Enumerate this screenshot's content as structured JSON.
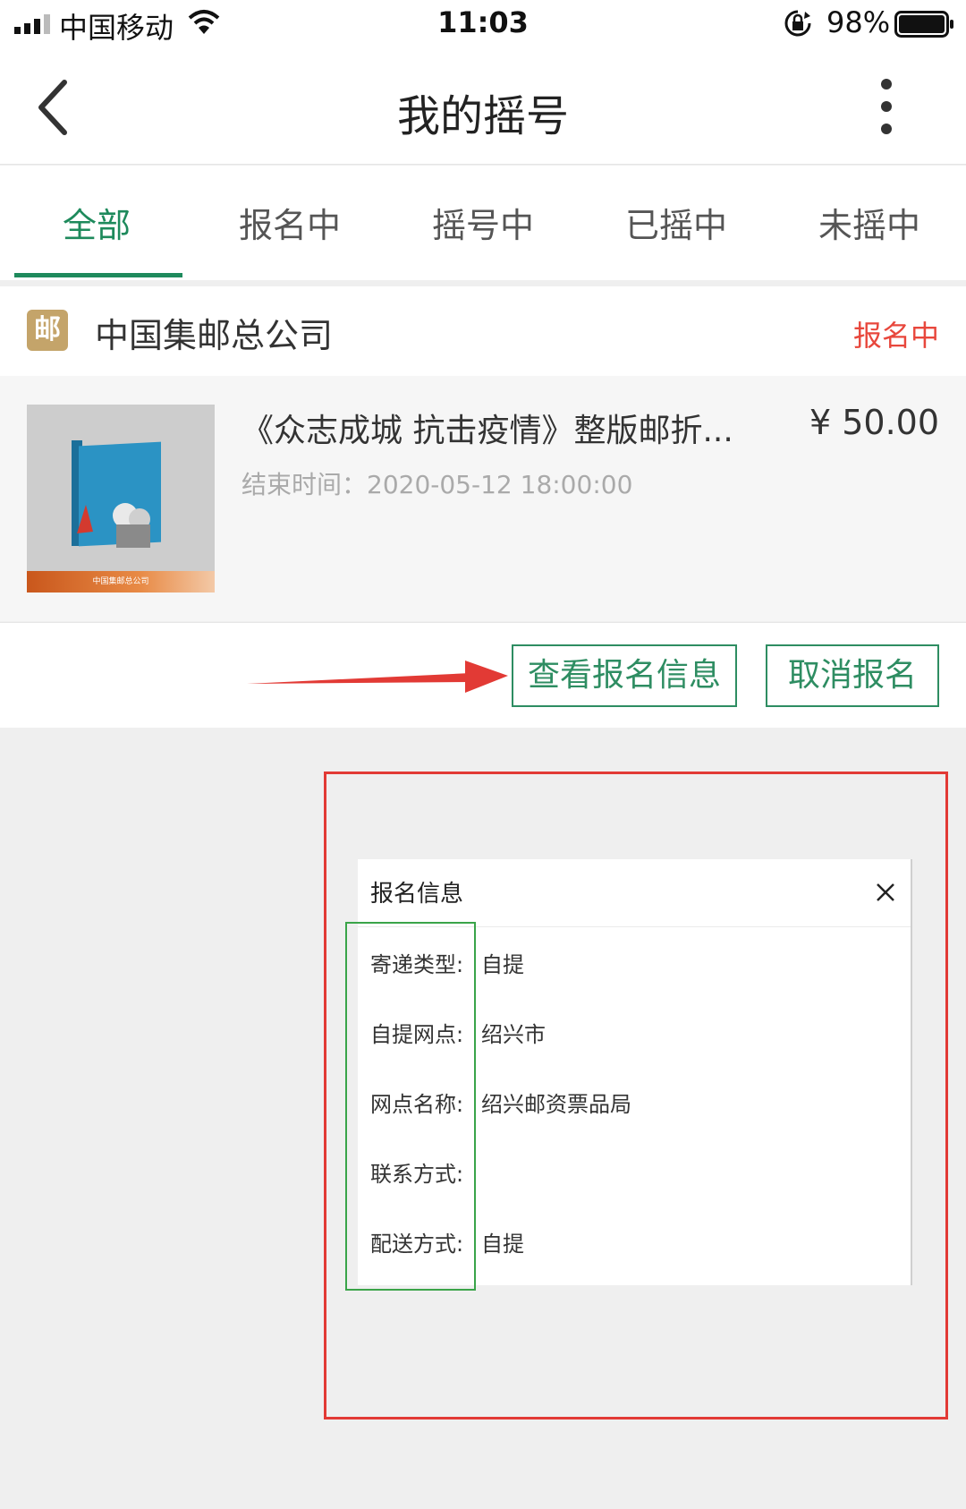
{
  "status_bar": {
    "carrier": "中国移动",
    "time": "11:03",
    "battery": "98%"
  },
  "nav": {
    "title": "我的摇号"
  },
  "tabs": [
    {
      "label": "全部",
      "active": true
    },
    {
      "label": "报名中",
      "active": false
    },
    {
      "label": "摇号中",
      "active": false
    },
    {
      "label": "已摇中",
      "active": false
    },
    {
      "label": "未摇中",
      "active": false
    }
  ],
  "shop": {
    "logo_char": "邮",
    "name": "中国集邮总公司",
    "status": "报名中"
  },
  "product": {
    "title": "《众志成城 抗击疫情》整版邮折...",
    "price": "¥ 50.00",
    "end_time": "结束时间：2020-05-12 18:00:00",
    "image_caption": "中国集邮总公司"
  },
  "actions": {
    "view_label": "查看报名信息",
    "cancel_label": "取消报名"
  },
  "dialog": {
    "title": "报名信息",
    "fields": [
      {
        "label": "寄递类型:",
        "value": "自提"
      },
      {
        "label": "自提网点:",
        "value": "绍兴市"
      },
      {
        "label": "网点名称:",
        "value": "绍兴邮资票品局"
      },
      {
        "label": "联系方式:",
        "value": ""
      },
      {
        "label": "配送方式:",
        "value": "自提"
      }
    ]
  },
  "colors": {
    "accent_green": "#1e8a5c",
    "status_red": "#e8473c",
    "annotation_red": "#e23a35",
    "annotation_green": "#3aa449"
  }
}
